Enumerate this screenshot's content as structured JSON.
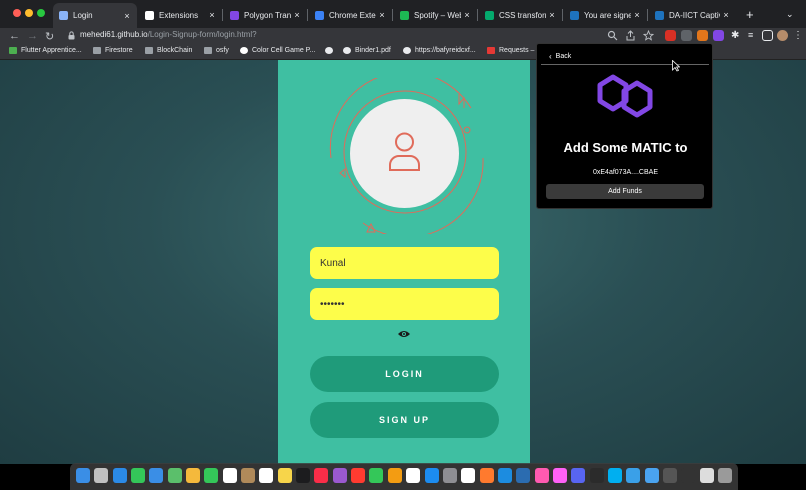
{
  "tabs": [
    {
      "label": "Login",
      "icon": "globe-icon",
      "color": "#8ab4f8",
      "active": true
    },
    {
      "label": "Extensions",
      "icon": "puzzle-icon",
      "color": "#ffffff"
    },
    {
      "label": "Polygon Transa",
      "icon": "polygon-icon",
      "color": "#8247e5"
    },
    {
      "label": "Chrome Extens",
      "icon": "v-icon",
      "color": "#3b82f6"
    },
    {
      "label": "Spotify – Web P",
      "icon": "spotify-icon",
      "color": "#1db954"
    },
    {
      "label": "CSS transform",
      "icon": "w3-icon",
      "color": "#04aa6d"
    },
    {
      "label": "You are signed",
      "icon": "s-icon",
      "color": "#1e73be"
    },
    {
      "label": "DA-IICT Captive",
      "icon": "s-icon",
      "color": "#1e73be"
    }
  ],
  "tab_close": "×",
  "new_tab": "+",
  "address": {
    "host": "mehedi61.github.io",
    "path": "/Login-Signup-form/login.html?"
  },
  "bookmarks": [
    {
      "label": "Flutter Apprentice...",
      "icon": "flutter-icon",
      "color": "#4caf50"
    },
    {
      "label": "Firestore",
      "icon": "folder-icon",
      "color": "#9aa0a6"
    },
    {
      "label": "BlockChain",
      "icon": "folder-icon",
      "color": "#9aa0a6"
    },
    {
      "label": "osfy",
      "icon": "folder-icon",
      "color": "#9aa0a6"
    },
    {
      "label": "Color Cell Game P...",
      "icon": "github-icon",
      "color": "#ffffff"
    },
    {
      "label": "",
      "icon": "globe-icon",
      "color": "#e8eaed"
    },
    {
      "label": "Binder1.pdf",
      "icon": "globe-icon",
      "color": "#e8eaed"
    },
    {
      "label": "https://bafyreidcxf...",
      "icon": "globe-icon",
      "color": "#e8eaed"
    },
    {
      "label": "Requests –",
      "icon": "heart-icon",
      "color": "#e53935"
    }
  ],
  "form": {
    "username": "Kunal",
    "password": "•••••••",
    "login_label": "LOGIN",
    "signup_label": "SIGN UP"
  },
  "wallet": {
    "back_label": "Back",
    "title": "Add Some MATIC to",
    "address": "0xE4af073A....CBAE",
    "add_funds_label": "Add Funds"
  },
  "colors": {
    "panel": "#3fbfa2",
    "field": "#fdfd4a",
    "button": "#1f9b7a",
    "orbit": "#e06b5a",
    "polygon": "#8247e5"
  },
  "dock_icons": [
    {
      "icon": "finder-icon",
      "color": "#3a8ee6"
    },
    {
      "icon": "launchpad-icon",
      "color": "#c0c0c0"
    },
    {
      "icon": "safari-icon",
      "color": "#2b8ae6"
    },
    {
      "icon": "messages-icon",
      "color": "#34c759"
    },
    {
      "icon": "mail-icon",
      "color": "#3a8ee6"
    },
    {
      "icon": "maps-icon",
      "color": "#5bbf6b"
    },
    {
      "icon": "photos-icon",
      "color": "#f5b93c"
    },
    {
      "icon": "facetime-icon",
      "color": "#34c759"
    },
    {
      "icon": "calendar-icon",
      "color": "#ffffff"
    },
    {
      "icon": "contacts-icon",
      "color": "#b08a5a"
    },
    {
      "icon": "reminders-icon",
      "color": "#ffffff"
    },
    {
      "icon": "notes-icon",
      "color": "#f7d54a"
    },
    {
      "icon": "tv-icon",
      "color": "#1c1c1e"
    },
    {
      "icon": "music-icon",
      "color": "#fa2d48"
    },
    {
      "icon": "podcasts-icon",
      "color": "#9b59d0"
    },
    {
      "icon": "news-icon",
      "color": "#ff3b30"
    },
    {
      "icon": "numbers-icon",
      "color": "#34c759"
    },
    {
      "icon": "pages-icon",
      "color": "#f39c12"
    },
    {
      "icon": "textedit-icon",
      "color": "#ffffff"
    },
    {
      "icon": "appstore-icon",
      "color": "#1c8cf0"
    },
    {
      "icon": "settings-icon",
      "color": "#8e8e93"
    },
    {
      "icon": "chrome-icon",
      "color": "#ffffff"
    },
    {
      "icon": "photoshop-icon",
      "color": "#ff7a2e"
    },
    {
      "icon": "vscode-icon",
      "color": "#1c8ce0"
    },
    {
      "icon": "sourcetree-icon",
      "color": "#2b6cb0"
    },
    {
      "icon": "anaconda-icon",
      "color": "#ff5ab0"
    },
    {
      "icon": "xd-icon",
      "color": "#ff61f6"
    },
    {
      "icon": "discord-icon",
      "color": "#5865f2"
    },
    {
      "icon": "terminal-icon",
      "color": "#2b2b2b"
    },
    {
      "icon": "skype-icon",
      "color": "#00aff0"
    },
    {
      "icon": "cleaner-icon",
      "color": "#3aa0e8"
    },
    {
      "icon": "folder-icon",
      "color": "#4aa3f0"
    },
    {
      "icon": "window-icon",
      "color": "#555555"
    },
    {
      "icon": "screen-icon",
      "color": "#333333"
    },
    {
      "icon": "sd-icon",
      "color": "#dddddd"
    },
    {
      "icon": "trash-icon",
      "color": "#9a9a9a"
    }
  ]
}
